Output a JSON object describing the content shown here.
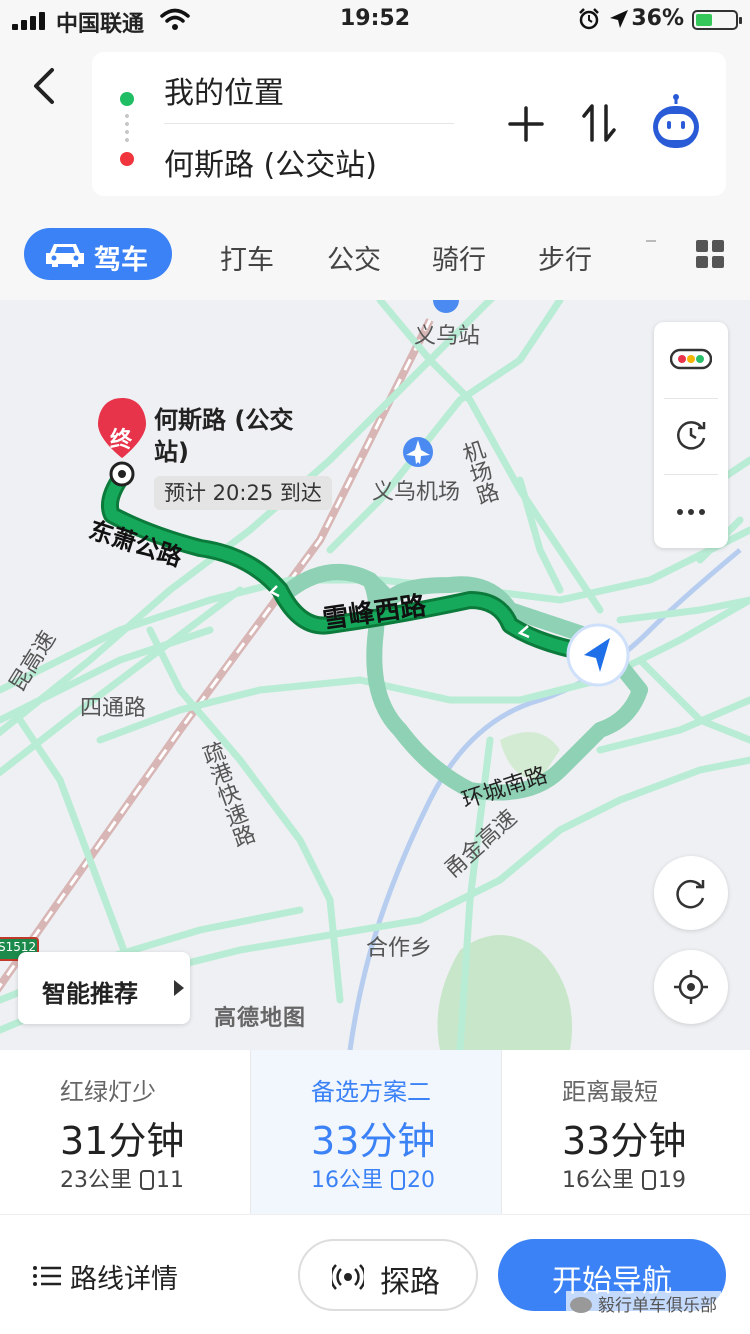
{
  "status_bar": {
    "carrier": "中国联通",
    "time": "19:52",
    "battery": "36%"
  },
  "route_input": {
    "origin": "我的位置",
    "destination": "何斯路 (公交站)"
  },
  "modes": {
    "active": "驾车",
    "taxi": "打车",
    "bus": "公交",
    "ride": "骑行",
    "walk": "步行"
  },
  "map": {
    "destination_title": "何斯路 (公交站)",
    "end_marker": "终",
    "eta": "预计 20:25 到达",
    "labels": {
      "yiwu_station": "义乌站",
      "yiwu_airport": "义乌机场",
      "airport_road": "机场路",
      "dongsu_road": "东萧公路",
      "xuefeng_west_road": "雪峰西路",
      "sitong_road": "四通路",
      "shugang_expressway": "疏港快速路",
      "huancheng_south_road": "环城南路",
      "yongjin_expressway": "甬金高速",
      "hezuo_township": "合作乡",
      "kunming_expressway": "昆高速",
      "highway_shield": "S1512"
    },
    "smart_recommend": "智能推荐",
    "logo": "高德地图",
    "colors": {
      "route_primary": "#109c4e",
      "route_secondary": "#8fd1b4",
      "road": "#b9ecd5",
      "accent": "#3b82f6"
    }
  },
  "options": [
    {
      "tag": "红绿灯少",
      "duration": "31分钟",
      "distance": "23公里",
      "lights": "11",
      "selected": false
    },
    {
      "tag": "备选方案二",
      "duration": "33分钟",
      "distance": "16公里",
      "lights": "20",
      "selected": true
    },
    {
      "tag": "距离最短",
      "duration": "33分钟",
      "distance": "16公里",
      "lights": "19",
      "selected": false
    }
  ],
  "bottom": {
    "details": "路线详情",
    "explore": "探路",
    "start": "开始导航",
    "watermark": "毅行单车俱乐部"
  }
}
